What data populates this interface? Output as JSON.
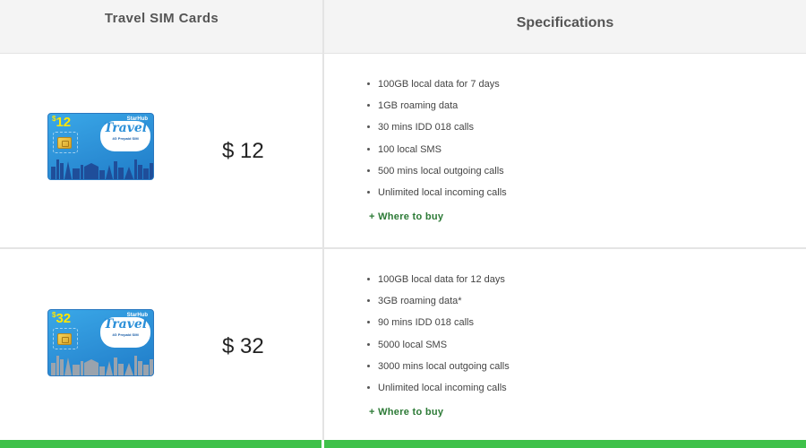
{
  "header": {
    "left_title": "Travel SIM Cards",
    "right_title": "Specifications"
  },
  "products": [
    {
      "price": "$ 12",
      "card": {
        "face_value": "12",
        "currency": "$",
        "brand": "StarHub",
        "logo_word": "Travel",
        "logo_sub": "4G Prepaid SIM",
        "skyline_color": "#1f4e9a"
      },
      "specs": [
        "100GB local data for 7 days",
        "1GB roaming data",
        "30 mins IDD 018 calls",
        "100 local SMS",
        "500 mins local outgoing calls",
        "Unlimited local incoming calls"
      ],
      "where_label": "+ Where to buy"
    },
    {
      "price": "$ 32",
      "card": {
        "face_value": "32",
        "currency": "$",
        "brand": "StarHub",
        "logo_word": "Travel",
        "logo_sub": "4G Prepaid SIM",
        "skyline_color": "#9aa3ad"
      },
      "specs": [
        "100GB local data for 12 days",
        "3GB roaming data*",
        "90 mins IDD 018 calls",
        "5000 local SMS",
        "3000 mins local outgoing calls",
        "Unlimited local incoming calls"
      ],
      "where_label": "+ Where to buy"
    }
  ],
  "colors": {
    "accent_green": "#3fc14a",
    "link_green": "#2c7a36",
    "header_bg": "#f4f4f4",
    "card_blue": "#2c8fd6"
  }
}
